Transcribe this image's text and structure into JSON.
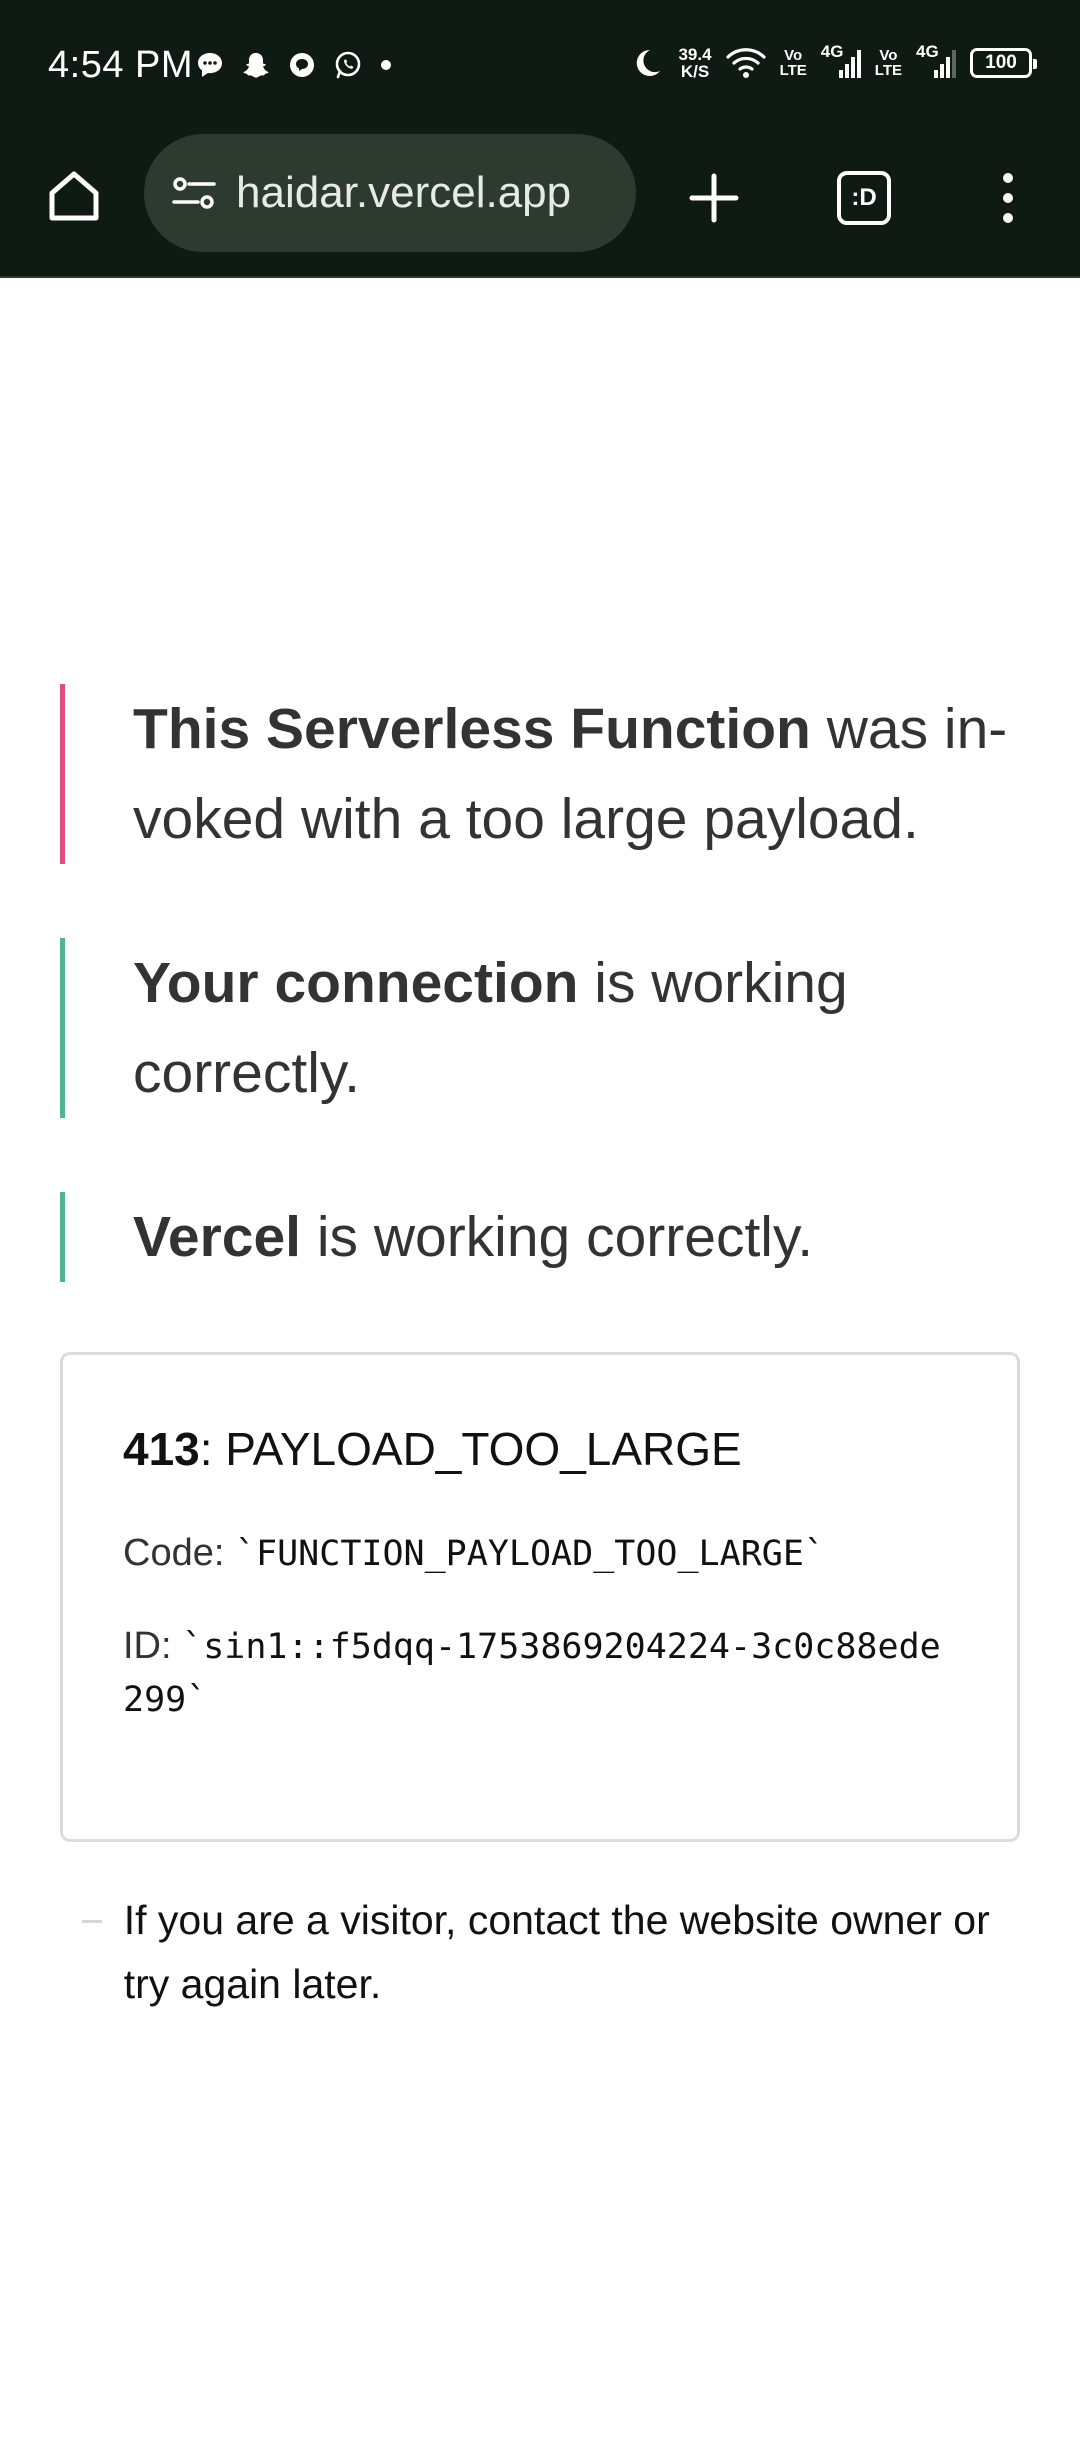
{
  "status_bar": {
    "time": "4:54 PM",
    "net_speed_value": "39.4",
    "net_speed_unit": "K/S",
    "volte_top": "Vo",
    "volte_bottom": "LTE",
    "signal_type": "4G",
    "battery": "100"
  },
  "browser": {
    "url": "haidar.vercel.app",
    "tabs_label": ":D"
  },
  "notices": [
    {
      "bold": "This Serverless Function",
      "text": " was in-voked with a too large payload.",
      "color": "#e14c7d"
    },
    {
      "bold": "Your connection",
      "text": " is working correctly.",
      "color": "#50b48e"
    },
    {
      "bold": "Vercel",
      "text": " is working correctly.",
      "color": "#50b48e"
    }
  ],
  "error": {
    "status_code": "413",
    "status_text": ": PAYLOAD_TOO_LARGE",
    "code_label": "Code: ",
    "code_value": "`FUNCTION_PAYLOAD_TOO_LARGE`",
    "id_label": "ID: ",
    "id_value": "`sin1::f5dqq-1753869204224-3c0c88ede299`"
  },
  "help_text": "If you are a visitor, contact the website owner or try again later."
}
